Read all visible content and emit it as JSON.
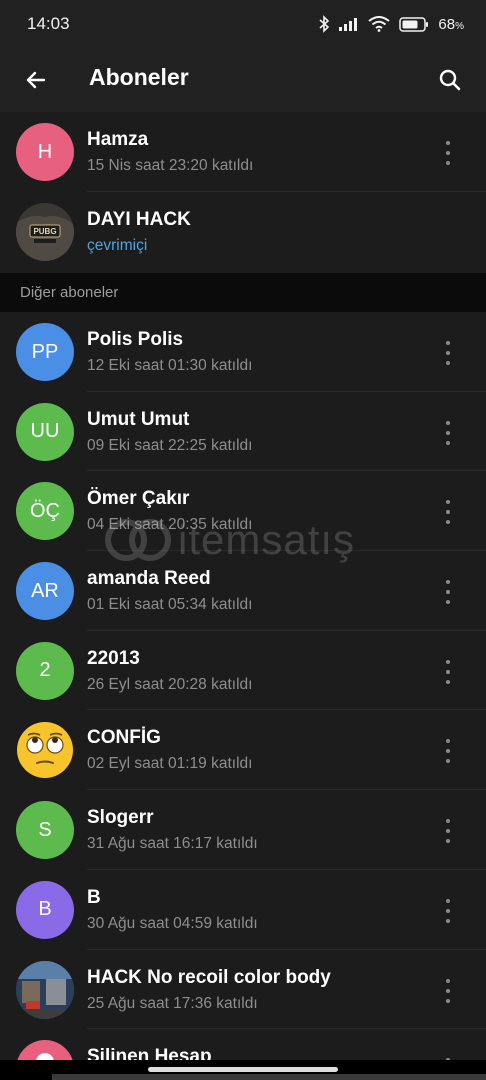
{
  "status_bar": {
    "time": "14:03",
    "battery_percent": "68",
    "battery_symbol": "%",
    "icons": [
      "bluetooth-icon",
      "signal-icon",
      "wifi-icon",
      "battery-icon"
    ]
  },
  "app_bar": {
    "title": "Aboneler",
    "back_icon": "arrow-left-icon",
    "search_icon": "search-icon"
  },
  "top_members": [
    {
      "name": "Hamza",
      "initials": "H",
      "avatar_color": "#e8607f",
      "subtitle": "15 Nis saat 23:20 katıldı",
      "has_menu": true
    },
    {
      "name": "DAYI HACK",
      "initials": "PUBG",
      "avatar_color": "#3a3a3a",
      "avatar_type": "image",
      "subtitle": "çevrimiçi",
      "online": true,
      "has_menu": false
    }
  ],
  "section_header": "Diğer aboneler",
  "other_members": [
    {
      "name": "Polis Polis",
      "initials": "PP",
      "avatar_color": "#4b8ee6",
      "subtitle": "12 Eki saat 01:30 katıldı"
    },
    {
      "name": "Umut Umut",
      "initials": "UU",
      "avatar_color": "#5dbb4e",
      "subtitle": "09 Eki saat 22:25 katıldı"
    },
    {
      "name": "Ömer Çakır",
      "initials": "ÖÇ",
      "avatar_color": "#5dbb4e",
      "subtitle": "04 Eki saat 20:35 katıldı"
    },
    {
      "name": "amanda Reed",
      "initials": "AR",
      "avatar_color": "#4b8ee6",
      "subtitle": "01 Eki saat 05:34 katıldı"
    },
    {
      "name": "22013",
      "initials": "2",
      "avatar_color": "#5dbb4e",
      "subtitle": "26 Eyl saat 20:28 katıldı"
    },
    {
      "name": "CONFİG",
      "initials": "",
      "avatar_color": "#f7c52b",
      "avatar_type": "emoji",
      "subtitle": "02 Eyl saat 01:19 katıldı"
    },
    {
      "name": "Slogerr",
      "initials": "S",
      "avatar_color": "#5dbb4e",
      "subtitle": "31 Ağu saat 16:17 katıldı"
    },
    {
      "name": "B",
      "initials": "B",
      "avatar_color": "#8a6ae6",
      "subtitle": "30 Ağu saat 04:59 katıldı"
    },
    {
      "name": "HACK No recoil color body",
      "initials": "",
      "avatar_color": "#2f4a6e",
      "avatar_type": "image",
      "subtitle": "25 Ağu saat 17:36 katıldı"
    },
    {
      "name": "Silinen Hesap",
      "initials": "",
      "avatar_color": "#e8607f",
      "subtitle": ""
    }
  ],
  "watermark": {
    "text": "itemsatış"
  },
  "menu_icon": "more-vertical-icon"
}
